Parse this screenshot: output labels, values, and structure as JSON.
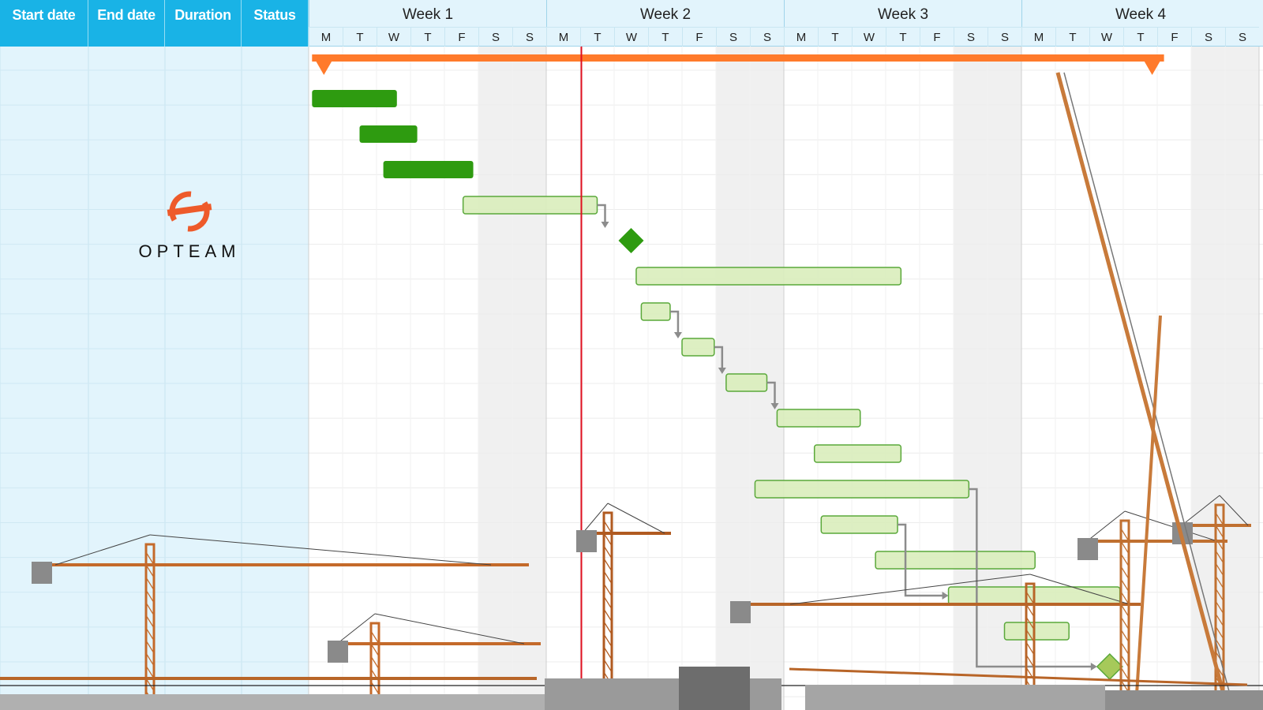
{
  "columns": [
    "Start date",
    "End date",
    "Duration",
    "Status"
  ],
  "weeks": [
    "Week 1",
    "Week 2",
    "Week 3",
    "Week 4"
  ],
  "day_letters": [
    "M",
    "T",
    "W",
    "T",
    "F",
    "S",
    "S"
  ],
  "logo": {
    "text": "OPTEAM",
    "icon": "opteam-logo-icon",
    "color": "#ee5a2a"
  },
  "colors": {
    "header": "#19b3e6",
    "summary_bar": "#ff7a2b",
    "done_task": "#2e9b10",
    "planned_task": "#d9edbb",
    "planned_border": "#5aa83a",
    "today_line": "#e01020",
    "dependency": "#8c8c8c"
  },
  "today_day": 8.0,
  "summary": {
    "start_day": 0.1,
    "end_day": 25.2
  },
  "tasks": [
    {
      "start_day": 0.1,
      "end_day": 2.6,
      "status": "done"
    },
    {
      "start_day": 1.5,
      "end_day": 3.2,
      "status": "done"
    },
    {
      "start_day": 2.2,
      "end_day": 4.85,
      "status": "done"
    },
    {
      "start_day": 4.55,
      "end_day": 8.5,
      "status": "planned"
    },
    {
      "start_day": 9.5,
      "end_day": 9.5,
      "status": "milestone"
    },
    {
      "start_day": 9.65,
      "end_day": 17.45,
      "status": "planned"
    },
    {
      "start_day": 9.8,
      "end_day": 10.65,
      "status": "planned"
    },
    {
      "start_day": 11.0,
      "end_day": 11.95,
      "status": "planned"
    },
    {
      "start_day": 12.3,
      "end_day": 13.5,
      "status": "planned"
    },
    {
      "start_day": 13.8,
      "end_day": 16.25,
      "status": "planned"
    },
    {
      "start_day": 14.9,
      "end_day": 17.45,
      "status": "planned"
    },
    {
      "start_day": 13.15,
      "end_day": 19.45,
      "status": "planned"
    },
    {
      "start_day": 15.1,
      "end_day": 17.35,
      "status": "planned"
    },
    {
      "start_day": 16.7,
      "end_day": 21.4,
      "status": "planned"
    },
    {
      "start_day": 18.85,
      "end_day": 23.9,
      "status": "planned"
    },
    {
      "start_day": 20.5,
      "end_day": 22.4,
      "status": "planned"
    },
    {
      "start_day": 23.6,
      "end_day": 23.6,
      "status": "milestone"
    }
  ],
  "dependencies": [
    {
      "from": 3,
      "to": 4
    },
    {
      "from": 6,
      "to": 7
    },
    {
      "from": 7,
      "to": 8
    },
    {
      "from": 8,
      "to": 9
    },
    {
      "from": 11,
      "to": 16
    },
    {
      "from": 12,
      "to": 14
    }
  ]
}
